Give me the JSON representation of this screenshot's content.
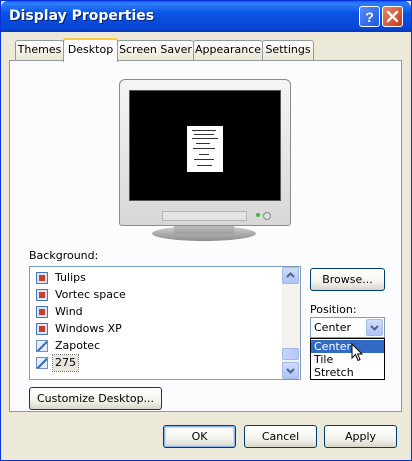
{
  "window": {
    "title": "Display Properties",
    "help_label": "?",
    "close_label": "✕"
  },
  "tabs": [
    {
      "label": "Themes",
      "active": false
    },
    {
      "label": "Desktop",
      "active": true
    },
    {
      "label": "Screen Saver",
      "active": false
    },
    {
      "label": "Appearance",
      "active": false
    },
    {
      "label": "Settings",
      "active": false
    }
  ],
  "desktop": {
    "background_label": "Background:",
    "background_items": [
      {
        "name": "Tulips",
        "icon": "image-icon"
      },
      {
        "name": "Vortec space",
        "icon": "image-icon"
      },
      {
        "name": "Wind",
        "icon": "image-icon"
      },
      {
        "name": "Windows XP",
        "icon": "image-icon"
      },
      {
        "name": "Zapotec",
        "icon": "pencil-image-icon"
      },
      {
        "name": "275",
        "icon": "pencil-image-icon",
        "selected": true
      }
    ],
    "browse_label": "Browse...",
    "position_label": "Position:",
    "position_value": "Center",
    "position_options": [
      "Center",
      "Tile",
      "Stretch"
    ],
    "position_highlighted": "Center",
    "customize_label": "Customize Desktop..."
  },
  "footer": {
    "ok_label": "OK",
    "cancel_label": "Cancel",
    "apply_label": "Apply"
  },
  "colors": {
    "titlebar": "#0054e3",
    "dialog_bg": "#ece9d8",
    "selection": "#316ac5",
    "active_tab_accent": "#ffc83c"
  }
}
